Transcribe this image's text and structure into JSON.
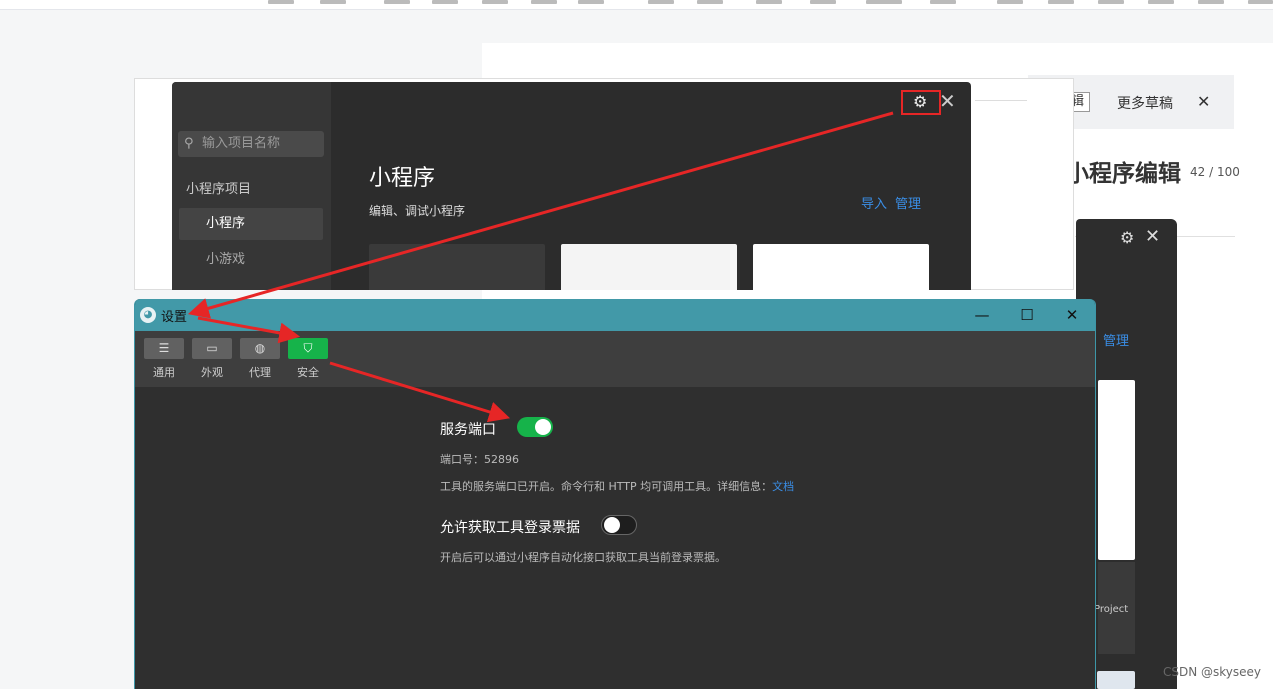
{
  "background_page": {
    "edit_label": "辑",
    "more_drafts": "更多草稿",
    "close_glyph": "✕",
    "title": "小程序编辑",
    "count": "42 / 100"
  },
  "rear_window": {
    "manage": "管理",
    "project": "Project"
  },
  "start_window": {
    "search_placeholder": "输入项目名称",
    "group_label": "小程序项目",
    "items": [
      {
        "label": "小程序"
      },
      {
        "label": "小游戏"
      }
    ],
    "heading": "小程序",
    "subheading": "编辑、调试小程序",
    "import": "导入",
    "manage": "管理",
    "gear_glyph": "⚙",
    "close_glyph": "✕"
  },
  "settings": {
    "title": "设置",
    "tabs": [
      {
        "label": "通用",
        "icon": "sliders-icon"
      },
      {
        "label": "外观",
        "icon": "window-icon"
      },
      {
        "label": "代理",
        "icon": "globe-icon"
      },
      {
        "label": "安全",
        "icon": "shield-icon",
        "active": true
      }
    ],
    "service_port": {
      "title": "服务端口",
      "enabled": true,
      "port_line": "端口号：52896",
      "desc": "工具的服务端口已开启。命令行和 HTTP 均可调用工具。详细信息：",
      "doc_link": "文档"
    },
    "login_ticket": {
      "title": "允许获取工具登录票据",
      "enabled": false,
      "desc": "开启后可以通过小程序自动化接口获取工具当前登录票据。"
    }
  },
  "colors": {
    "accent_green": "#16b34a",
    "titlebar_teal": "#4299a8",
    "annotation_red": "#e62626",
    "link_blue": "#3a8ee6"
  },
  "watermark": "CSDN @skyseey"
}
